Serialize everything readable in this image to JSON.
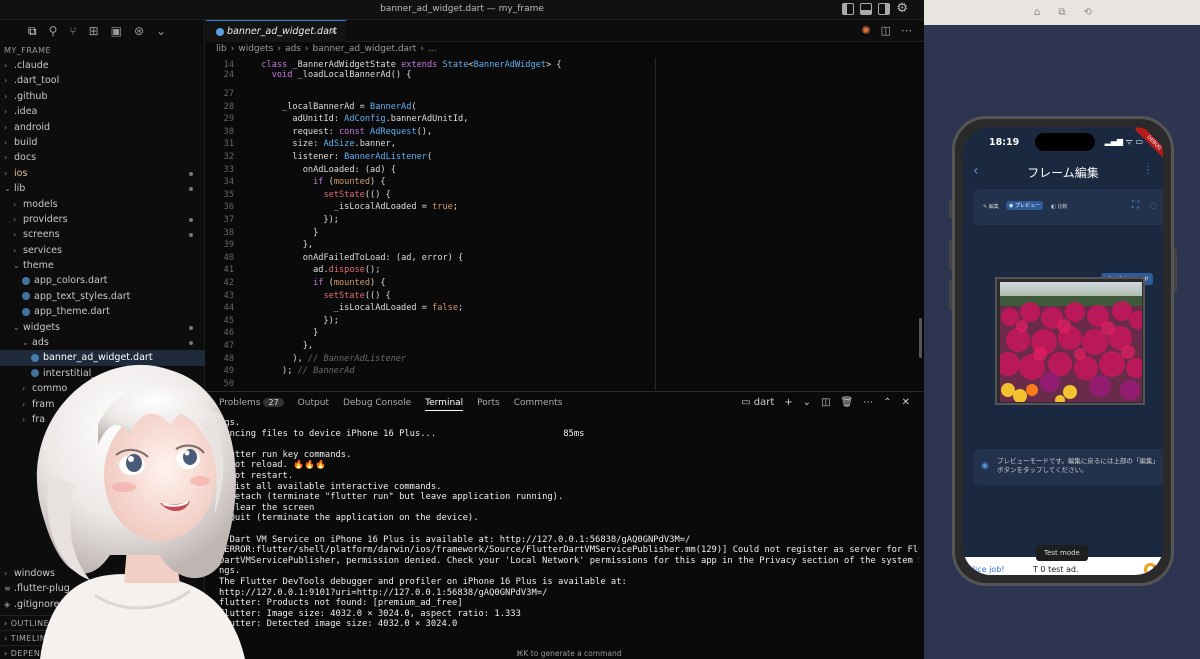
{
  "window": {
    "title": "banner_ad_widget.dart — my_frame"
  },
  "activity_icons": [
    "⧉",
    "⚲",
    "⑂",
    "⊞",
    "▣",
    "⊛",
    "⌄"
  ],
  "explorer": {
    "root": "MY_FRAME",
    "items": [
      {
        "label": ".claude",
        "depth": 1,
        "chev": "›"
      },
      {
        "label": ".dart_tool",
        "depth": 1,
        "chev": "›"
      },
      {
        "label": ".github",
        "depth": 1,
        "chev": "›"
      },
      {
        "label": ".idea",
        "depth": 1,
        "chev": "›"
      },
      {
        "label": "android",
        "depth": 1,
        "chev": "›"
      },
      {
        "label": "build",
        "depth": 1,
        "chev": "›"
      },
      {
        "label": "docs",
        "depth": 1,
        "chev": "›"
      },
      {
        "label": "ios",
        "depth": 1,
        "chev": "›",
        "dot": true,
        "ios": true
      },
      {
        "label": "lib",
        "depth": 1,
        "chev": "⌄",
        "dot": true
      },
      {
        "label": "models",
        "depth": 2,
        "chev": "›"
      },
      {
        "label": "providers",
        "depth": 2,
        "chev": "›",
        "dot": true
      },
      {
        "label": "screens",
        "depth": 2,
        "chev": "›",
        "dot": true
      },
      {
        "label": "services",
        "depth": 2,
        "chev": "›"
      },
      {
        "label": "theme",
        "depth": 2,
        "chev": "⌄"
      },
      {
        "label": "app_colors.dart",
        "depth": 3,
        "file": true
      },
      {
        "label": "app_text_styles.dart",
        "depth": 3,
        "file": true
      },
      {
        "label": "app_theme.dart",
        "depth": 3,
        "file": true
      },
      {
        "label": "widgets",
        "depth": 2,
        "chev": "⌄",
        "dot": true
      },
      {
        "label": "ads",
        "depth": 3,
        "chev": "⌄",
        "dot": true
      },
      {
        "label": "banner_ad_widget.dart",
        "depth": 4,
        "file": true,
        "selected": true
      },
      {
        "label": "interstitial_",
        "depth": 4,
        "file": true
      },
      {
        "label": "commo",
        "depth": 3,
        "chev": "›"
      },
      {
        "label": "fram",
        "depth": 3,
        "chev": "›"
      },
      {
        "label": "fra",
        "depth": 3,
        "chev": "›"
      },
      {
        "label": "",
        "depth": 3
      },
      {
        "label": "",
        "depth": 3
      },
      {
        "label": "",
        "depth": 3
      },
      {
        "label": "",
        "depth": 3
      },
      {
        "label": "",
        "depth": 3
      },
      {
        "label": "",
        "depth": 1
      },
      {
        "label": "",
        "depth": 1
      },
      {
        "label": "",
        "depth": 1
      },
      {
        "label": "",
        "depth": 1
      },
      {
        "label": "windows",
        "depth": 1,
        "chev": "›"
      },
      {
        "label": ".flutter-plug",
        "depth": 1,
        "glyph": "≡"
      },
      {
        "label": ".gitignore",
        "depth": 1,
        "glyph": "◈"
      }
    ],
    "sections": [
      "OUTLINE",
      "TIMELINE",
      "DEPEND"
    ]
  },
  "editor": {
    "tab_label": "banner_ad_widget.dart",
    "tab_close": "✕",
    "tab_actions": [
      "✺",
      "◫",
      "⋯"
    ],
    "breadcrumb": [
      "lib",
      "›",
      "widgets",
      "›",
      "ads",
      "›",
      "banner_ad_widget.dart",
      "›",
      "..."
    ],
    "sticky": [
      {
        "n": "14",
        "t": "  class _BannerAdWidgetState extends State<BannerAdWidget> {"
      },
      {
        "n": "24",
        "t": "    void _loadLocalBannerAd() {"
      }
    ],
    "lines": [
      {
        "n": "27",
        "t": ""
      },
      {
        "n": "28",
        "t": "      _localBannerAd = BannerAd("
      },
      {
        "n": "29",
        "t": "        adUnitId: AdConfig.bannerAdUnitId,"
      },
      {
        "n": "30",
        "t": "        request: const AdRequest(),"
      },
      {
        "n": "31",
        "t": "        size: AdSize.banner,"
      },
      {
        "n": "32",
        "t": "        listener: BannerAdListener("
      },
      {
        "n": "33",
        "t": "          onAdLoaded: (ad) {"
      },
      {
        "n": "34",
        "t": "            if (mounted) {"
      },
      {
        "n": "35",
        "t": "              setState(() {"
      },
      {
        "n": "36",
        "t": "                _isLocalAdLoaded = true;"
      },
      {
        "n": "37",
        "t": "              });"
      },
      {
        "n": "38",
        "t": "            }"
      },
      {
        "n": "39",
        "t": "          },"
      },
      {
        "n": "40",
        "t": "          onAdFailedToLoad: (ad, error) {"
      },
      {
        "n": "41",
        "t": "            ad.dispose();"
      },
      {
        "n": "42",
        "t": "            if (mounted) {"
      },
      {
        "n": "43",
        "t": "              setState(() {"
      },
      {
        "n": "44",
        "t": "                _isLocalAdLoaded = false;"
      },
      {
        "n": "45",
        "t": "              });"
      },
      {
        "n": "46",
        "t": "            }"
      },
      {
        "n": "47",
        "t": "          },"
      },
      {
        "n": "48",
        "t": "        ), // BannerAdListener"
      },
      {
        "n": "49",
        "t": "      ); // BannerAd"
      },
      {
        "n": "50",
        "t": ""
      }
    ]
  },
  "panel": {
    "tabs": [
      "Problems",
      "Output",
      "Debug Console",
      "Terminal",
      "Ports",
      "Comments"
    ],
    "problems_count": "27",
    "active_tab": "Terminal",
    "terminal_name": "dart",
    "actions": [
      "+",
      "⌄",
      "◫",
      "🗑",
      "⋯",
      "⌃",
      "✕"
    ],
    "terminal_lines": [
      "ngs.",
      "Syncing files to device iPhone 16 Plus...                        85ms",
      "",
      "Flutter run key commands.",
      "r Hot reload. 🔥🔥🔥",
      "R Hot restart.",
      "h List all available interactive commands.",
      "d Detach (terminate \"flutter run\" but leave application running).",
      "c Clear the screen",
      "q Quit (terminate the application on the device).",
      "",
      "A Dart VM Service on iPhone 16 Plus is available at: http://127.0.0.1:56838/gAQ0GNPdV3M=/",
      "[ERROR:flutter/shell/platform/darwin/ios/framework/Source/FlutterDartVMServicePublisher.mm(129)] Could not register as server for Flutter",
      "DartVMServicePublisher, permission denied. Check your 'Local Network' permissions for this app in the Privacy section of the system Setti",
      "ngs.",
      "The Flutter DevTools debugger and profiler on iPhone 16 Plus is available at:",
      "http://127.0.0.1:9101?uri=http://127.0.0.1:56838/gAQ0GNPdV3M=/",
      "flutter: Products not found: [premium_ad_free]",
      "flutter: Image size: 4032.0 × 3024.0, aspect ratio: 1.333",
      "flutter: Detected image size: 4032.0 × 3024.0"
    ],
    "cmd_hint": "⌘K to generate a command"
  },
  "simulator": {
    "toolbar_icons": [
      "⌂",
      "⧉",
      "⟲"
    ],
    "time": "18:19",
    "status": "▂▄▆ ᯤ ▭",
    "debug_ribbon": "DEBUG",
    "nav": {
      "back": "‹",
      "title": "フレーム編集",
      "more": "⋮"
    },
    "mode_tabs": [
      "✎ 編集",
      "◉ プレビュー",
      "◧ 比較"
    ],
    "mode_icons": [
      "⛶",
      "◌"
    ],
    "preview_badge": "プレビューモード",
    "info_icon": "◉",
    "info_text": "プレビューモードです。編集に戻るには上部の「編集」ボタンをタップしてください。",
    "ad": {
      "nice": "Nice job!",
      "text": "T         0 test ad."
    },
    "test_mode": "Test mode"
  },
  "colors": {
    "accent": "#3a82d6",
    "keyword": "#c678dd",
    "type": "#61afef",
    "sim_bg": "#2d3550"
  }
}
